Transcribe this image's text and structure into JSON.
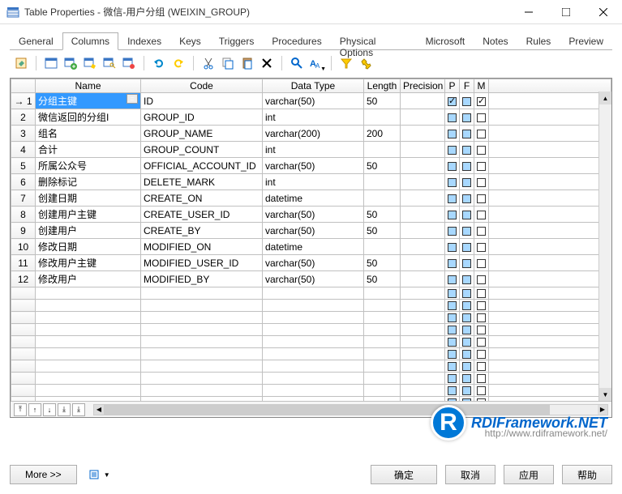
{
  "window": {
    "title": "Table Properties - 微信-用户分组 (WEIXIN_GROUP)"
  },
  "tabs": [
    "General",
    "Columns",
    "Indexes",
    "Keys",
    "Triggers",
    "Procedures",
    "Physical Options",
    "Microsoft",
    "Notes",
    "Rules",
    "Preview"
  ],
  "active_tab": "Columns",
  "headers": {
    "name": "Name",
    "code": "Code",
    "dtype": "Data Type",
    "length": "Length",
    "precision": "Precision",
    "p": "P",
    "f": "F",
    "m": "M"
  },
  "rows": [
    {
      "n": "1",
      "name": "分组主键",
      "code": "ID",
      "dtype": "varchar(50)",
      "len": "50",
      "prec": "",
      "p": true,
      "f": false,
      "m": true,
      "sel": true
    },
    {
      "n": "2",
      "name": "微信返回的分组I",
      "code": "GROUP_ID",
      "dtype": "int",
      "len": "",
      "prec": "",
      "p": false,
      "f": false,
      "m": false
    },
    {
      "n": "3",
      "name": "组名",
      "code": "GROUP_NAME",
      "dtype": "varchar(200)",
      "len": "200",
      "prec": "",
      "p": false,
      "f": false,
      "m": false
    },
    {
      "n": "4",
      "name": "合计",
      "code": "GROUP_COUNT",
      "dtype": "int",
      "len": "",
      "prec": "",
      "p": false,
      "f": false,
      "m": false
    },
    {
      "n": "5",
      "name": "所属公众号",
      "code": "OFFICIAL_ACCOUNT_ID",
      "dtype": "varchar(50)",
      "len": "50",
      "prec": "",
      "p": false,
      "f": false,
      "m": false
    },
    {
      "n": "6",
      "name": "删除标记",
      "code": "DELETE_MARK",
      "dtype": "int",
      "len": "",
      "prec": "",
      "p": false,
      "f": false,
      "m": false
    },
    {
      "n": "7",
      "name": "创建日期",
      "code": "CREATE_ON",
      "dtype": "datetime",
      "len": "",
      "prec": "",
      "p": false,
      "f": false,
      "m": false
    },
    {
      "n": "8",
      "name": "创建用户主键",
      "code": "CREATE_USER_ID",
      "dtype": "varchar(50)",
      "len": "50",
      "prec": "",
      "p": false,
      "f": false,
      "m": false
    },
    {
      "n": "9",
      "name": "创建用户",
      "code": "CREATE_BY",
      "dtype": "varchar(50)",
      "len": "50",
      "prec": "",
      "p": false,
      "f": false,
      "m": false
    },
    {
      "n": "10",
      "name": "修改日期",
      "code": "MODIFIED_ON",
      "dtype": "datetime",
      "len": "",
      "prec": "",
      "p": false,
      "f": false,
      "m": false
    },
    {
      "n": "11",
      "name": "修改用户主键",
      "code": "MODIFIED_USER_ID",
      "dtype": "varchar(50)",
      "len": "50",
      "prec": "",
      "p": false,
      "f": false,
      "m": false
    },
    {
      "n": "12",
      "name": "修改用户",
      "code": "MODIFIED_BY",
      "dtype": "varchar(50)",
      "len": "50",
      "prec": "",
      "p": false,
      "f": false,
      "m": false
    }
  ],
  "empty_rows": 16,
  "buttons": {
    "more": "More >>",
    "ok": "确定",
    "cancel": "取消",
    "apply": "应用",
    "help": "帮助"
  },
  "watermark": {
    "text": "RDIFramework.NET",
    "url": "http://www.rdiframework.net/"
  }
}
